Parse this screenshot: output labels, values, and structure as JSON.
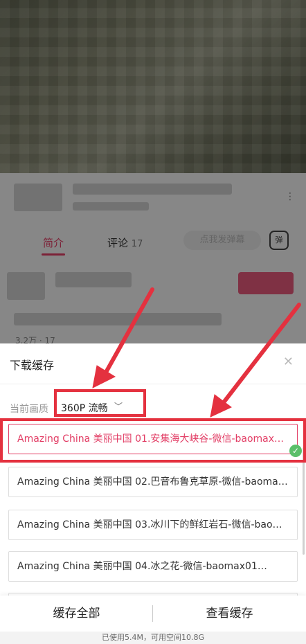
{
  "info": {
    "tabs": [
      {
        "label": "简介"
      },
      {
        "label": "评论",
        "count": "17"
      }
    ],
    "danmu_placeholder": "点我发弹幕",
    "danmu_icon": "弹",
    "stats": "3.2万 · 17"
  },
  "sheet": {
    "title": "下载缓存",
    "close_icon": "✕",
    "quality_label": "当前画质",
    "quality_value": "360P 流畅",
    "quality_chevron": "﹀",
    "items": [
      {
        "label": "Amazing China 美丽中国 01.安集海大峡谷-微信-baomax01…",
        "selected": true
      },
      {
        "label": "Amazing China 美丽中国 02.巴音布鲁克草原-微信-baomax01…",
        "selected": false
      },
      {
        "label": "Amazing China 美丽中国 03.冰川下的鲜红岩石-微信-baomax01…",
        "selected": false
      },
      {
        "label": "Amazing China 美丽中国 04.冰之花-微信-baomax01…",
        "selected": false
      }
    ],
    "check_icon": "✓"
  },
  "bottom": {
    "cache_all": "缓存全部",
    "view_cache": "查看缓存",
    "storage": "已使用5.4M，可用空间10.8G"
  },
  "colors": {
    "accent": "#e23c64",
    "annotation": "#e4313f",
    "check": "#5bbf6a"
  }
}
